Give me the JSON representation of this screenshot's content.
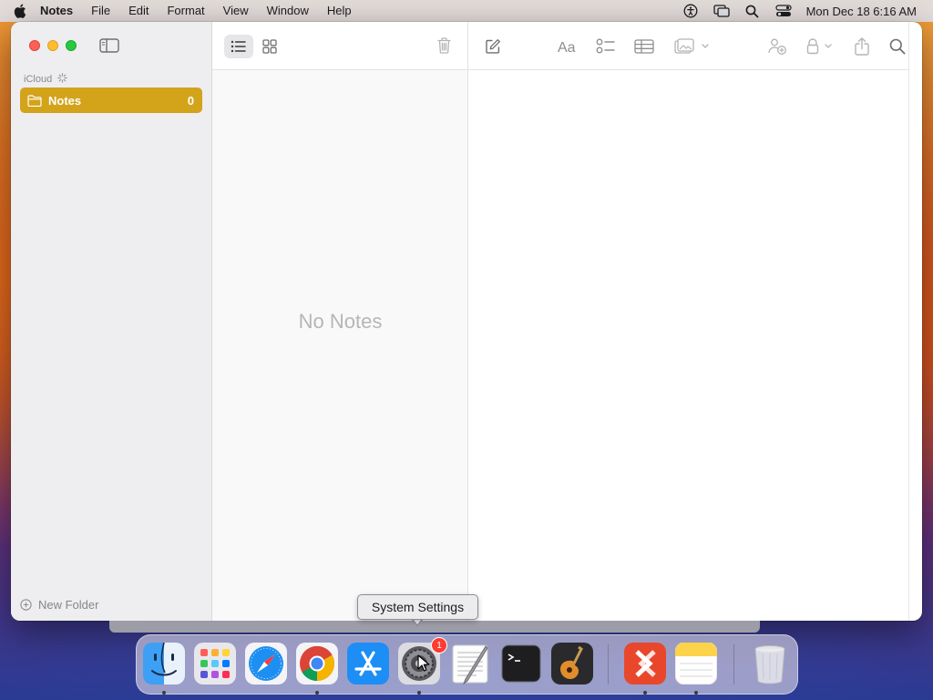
{
  "menubar": {
    "app_name": "Notes",
    "menus": [
      "File",
      "Edit",
      "Format",
      "View",
      "Window",
      "Help"
    ],
    "status_icons": [
      "accessibility-icon",
      "screen-mirroring-icon",
      "spotlight-search-icon",
      "control-center-icon"
    ],
    "clock": "Mon Dec 18  6:16 AM"
  },
  "sidebar": {
    "account_label": "iCloud",
    "folders": [
      {
        "name": "Notes",
        "count": "0",
        "selected": true
      }
    ],
    "new_folder_label": "New Folder"
  },
  "note_list": {
    "empty_message": "No Notes",
    "toolbar": [
      "list-view-icon",
      "gallery-view-icon",
      "trash-icon"
    ]
  },
  "editor": {
    "toolbar": [
      "compose-icon",
      "format-text-icon",
      "checklist-icon",
      "table-icon",
      "media-icon",
      "collaborate-icon",
      "lock-icon",
      "share-icon",
      "search-icon"
    ]
  },
  "tooltip": {
    "text": "System Settings"
  },
  "dock": {
    "apps": [
      {
        "name": "Finder",
        "icon": "finder-icon",
        "running": true
      },
      {
        "name": "Launchpad",
        "icon": "launchpad-icon",
        "running": false
      },
      {
        "name": "Safari",
        "icon": "safari-icon",
        "running": false
      },
      {
        "name": "Google Chrome",
        "icon": "chrome-icon",
        "running": true
      },
      {
        "name": "App Store",
        "icon": "app-store-icon",
        "running": false
      },
      {
        "name": "System Settings",
        "icon": "system-settings-icon",
        "running": true,
        "badge": "1"
      },
      {
        "name": "TextEdit",
        "icon": "textedit-icon",
        "running": false
      },
      {
        "name": "Terminal",
        "icon": "terminal-icon",
        "running": false
      },
      {
        "name": "GarageBand",
        "icon": "garageband-icon",
        "running": false
      },
      {
        "name": "Remote Desktop",
        "icon": "remote-desktop-icon",
        "running": true
      },
      {
        "name": "Notes",
        "icon": "notes-icon",
        "running": true
      },
      {
        "name": "Trash",
        "icon": "trash-icon",
        "running": false
      }
    ]
  },
  "colors": {
    "accent": "#d3a31a",
    "close": "#fe5f57",
    "minimize": "#febc2e",
    "maximize": "#28c840"
  }
}
